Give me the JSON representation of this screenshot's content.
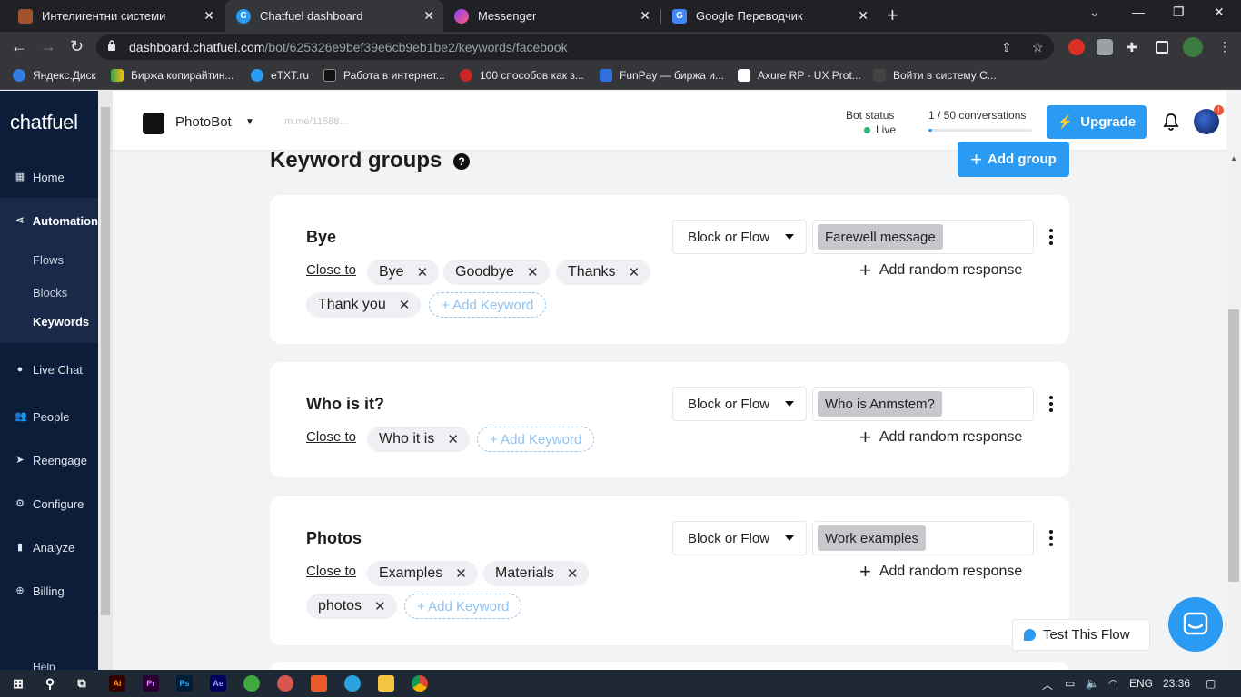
{
  "browser": {
    "tabs": [
      {
        "title": "Интелигентни системи",
        "active": false
      },
      {
        "title": "Chatfuel dashboard",
        "active": true
      },
      {
        "title": "Messenger",
        "active": false
      },
      {
        "title": "Google Переводчик",
        "active": false
      }
    ],
    "url_domain": "dashboard.chatfuel.com",
    "url_path": "/bot/625326e9bef39e6cb9eb1be2/keywords/facebook",
    "bookmarks": [
      "Яндекс.Диск",
      "Биржа копирайтин...",
      "eTXT.ru",
      "Работа в интернет...",
      "100 способов как з...",
      "FunPay — биржа и...",
      "Axure RP - UX Prot...",
      "Войти в систему С..."
    ]
  },
  "sidebar": {
    "logo": "chatfuel",
    "items": [
      {
        "label": "Home",
        "icon": "grid-icon"
      },
      {
        "label": "Automation",
        "icon": "share-nodes-icon"
      },
      {
        "label": "Live Chat",
        "icon": "chat-bubble-icon"
      },
      {
        "label": "People",
        "icon": "people-icon"
      },
      {
        "label": "Reengage",
        "icon": "send-icon"
      },
      {
        "label": "Configure",
        "icon": "gear-icon"
      },
      {
        "label": "Analyze",
        "icon": "bar-chart-icon"
      },
      {
        "label": "Billing",
        "icon": "plus-circle-icon"
      }
    ],
    "sub_items": [
      "Flows",
      "Blocks",
      "Keywords"
    ],
    "help": "Help"
  },
  "header": {
    "bot_name": "PhotoBot",
    "bot_link": "m.me/11588...",
    "bot_status_label": "Bot status",
    "bot_status_value": "Live",
    "conversations": "1 / 50 conversations",
    "conversations_fraction": 0.02,
    "upgrade_label": "Upgrade"
  },
  "main": {
    "title": "Keyword groups",
    "add_group_label": "Add group",
    "close_to_label": "Close to",
    "add_keyword_label": "+ Add Keyword",
    "select_label": "Block or Flow",
    "random_response_label": "Add random response",
    "groups": [
      {
        "name": "Bye",
        "keywords": [
          "Bye",
          "Goodbye",
          "Thanks",
          "Thank you"
        ],
        "block": "Farewell message"
      },
      {
        "name": "Who is it?",
        "keywords": [
          "Who it is"
        ],
        "block": "Who is Anmstem?"
      },
      {
        "name": "Photos",
        "keywords": [
          "Examples",
          "Materials",
          "photos"
        ],
        "block": "Work examples"
      }
    ]
  },
  "floating": {
    "test_flow_label": "Test This Flow"
  },
  "taskbar": {
    "language": "ENG",
    "time": "23:36"
  },
  "colors": {
    "sidebar_bg": "#0c1d3a",
    "accent": "#2a9af2",
    "live": "#2bb673"
  }
}
